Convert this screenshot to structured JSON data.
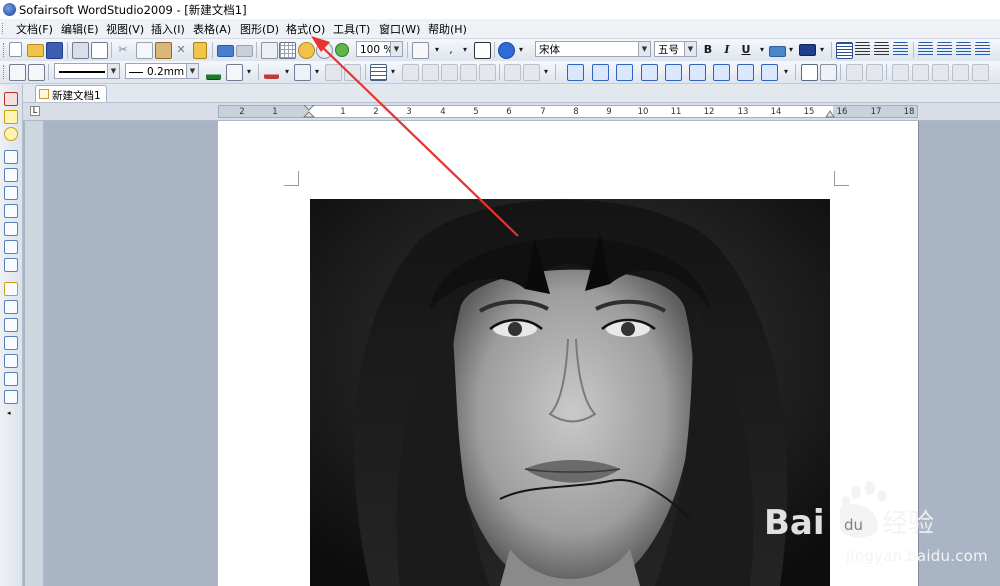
{
  "window": {
    "title": "Sofairsoft WordStudio2009 - [新建文档1]"
  },
  "menu": [
    {
      "label": "文档(F)"
    },
    {
      "label": "编辑(E)"
    },
    {
      "label": "视图(V)"
    },
    {
      "label": "插入(I)"
    },
    {
      "label": "表格(A)"
    },
    {
      "label": "图形(D)"
    },
    {
      "label": "格式(O)"
    },
    {
      "label": "工具(T)"
    },
    {
      "label": "窗口(W)"
    },
    {
      "label": "帮助(H)"
    }
  ],
  "toolbar1": {
    "zoom": "100 %",
    "font_name": "宋体",
    "font_size": "五号",
    "bold": "B",
    "italic": "I",
    "underline": "U"
  },
  "toolbar2": {
    "line_width": "0.2mm"
  },
  "tabs": {
    "document": "新建文档1"
  },
  "ruler": {
    "ticks": [
      "2",
      "1",
      "1",
      "2",
      "3",
      "4",
      "5",
      "6",
      "7",
      "8",
      "9",
      "10",
      "11",
      "12",
      "13",
      "14",
      "15",
      "16",
      "17",
      "18"
    ]
  },
  "watermark": {
    "brand": "Baidu经验",
    "url": "jingyan.baidu.com"
  },
  "colors": {
    "arrow": "#e8322d",
    "workspace": "#a9b5c4",
    "accent": "#2a5ab0"
  }
}
